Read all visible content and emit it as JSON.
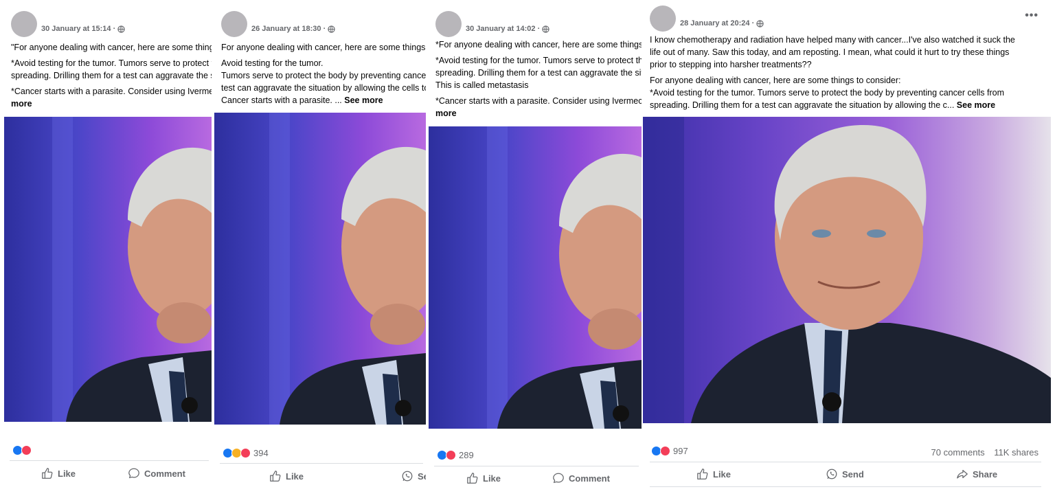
{
  "posts": [
    {
      "timestamp": "30 January at 15:14 ·",
      "paragraphs": [
        "\"For anyone dealing with cancer, here are some things to consider:",
        "*Avoid testing for the tumor. Tumors serve to protect the body by preventing cancer cells from",
        "spreading. Drilling them for a test can aggravate the situation",
        "*Cancer starts with a parasite. Consider using Ivermectin..."
      ],
      "see_more": "more",
      "reaction_count": "",
      "actions": [
        "Like",
        "Comment"
      ]
    },
    {
      "timestamp": "26 January at 18:30 ·",
      "paragraphs": [
        "For anyone dealing with cancer, here are some things to consider:",
        "Avoid testing for the tumor.",
        "Tumors serve to protect the body by preventing cancer cells from spreading. Drilling them for a",
        "test can aggravate the situation by allowing the cells to spread.",
        "Cancer starts with a parasite. ..."
      ],
      "see_more": "See more",
      "reaction_count": "394",
      "actions": [
        "Like",
        "Send"
      ]
    },
    {
      "timestamp": "30 January at 14:02 ·",
      "paragraphs": [
        "*For anyone dealing with cancer, here are some things to consider:",
        "*Avoid testing for the tumor. Tumors serve to protect the body by preventing cancer cells from",
        "spreading. Drilling them for a test can aggravate the situation by allowing the cells to spread.",
        "This is called metastasis",
        "*Cancer starts with a parasite. Consider using Ivermectin..."
      ],
      "see_more": "more",
      "reaction_count": "289",
      "actions": [
        "Like",
        "Comment"
      ]
    },
    {
      "timestamp": "28 January at 20:24 ·",
      "paragraphs": [
        "I know chemotherapy and radiation have helped many with cancer...I've also watched it suck the",
        "life out of many. Saw this today, and am reposting. I mean, what could it hurt to try these things",
        "prior to stepping into harsher treatments??",
        " For anyone dealing with cancer, here are some things to consider:",
        "*Avoid testing for the tumor. Tumors serve to protect the body by preventing cancer cells from",
        "spreading. Drilling them for a test can aggravate the situation by allowing the c..."
      ],
      "see_more": "See more",
      "reaction_count": "997",
      "comments": "70 comments",
      "shares": "11K shares",
      "actions": [
        "Like",
        "Send",
        "Share"
      ]
    }
  ],
  "icons": {
    "like": "thumbs-up-icon",
    "comment": "comment-bubble-icon",
    "send": "whatsapp-send-icon",
    "share": "share-arrow-icon",
    "privacy": "globe-icon"
  },
  "colors": {
    "like_blue": "#1877f2",
    "love_red": "#f33e58",
    "haha_yellow": "#f7b125",
    "meta_gray": "#65676b"
  }
}
